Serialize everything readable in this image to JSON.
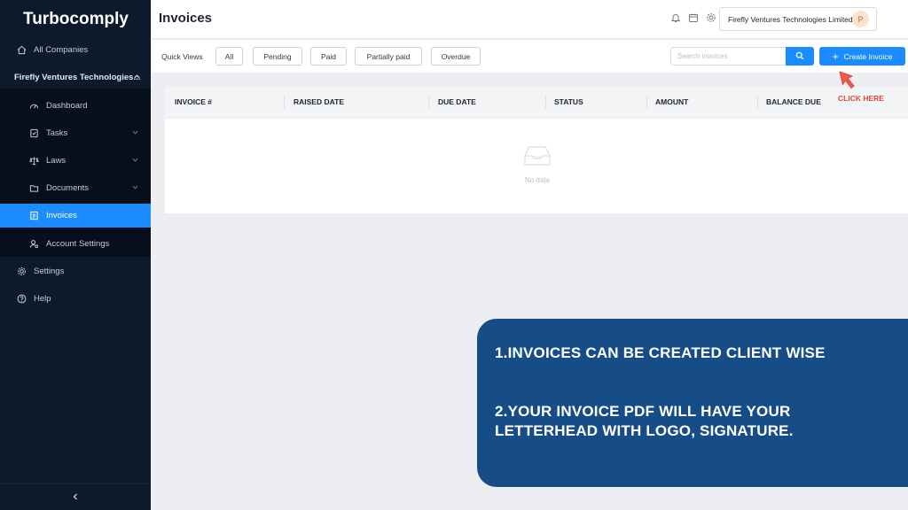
{
  "sidebar": {
    "brand": "Turbocomply",
    "all_companies": "All Companies",
    "company": "Firefly Ventures Technologies...",
    "items": [
      {
        "label": "Dashboard"
      },
      {
        "label": "Tasks"
      },
      {
        "label": "Laws"
      },
      {
        "label": "Documents"
      },
      {
        "label": "Invoices"
      },
      {
        "label": "Account Settings"
      }
    ],
    "settings": "Settings",
    "help": "Help",
    "collapse_icon": "chevron-left-icon"
  },
  "header": {
    "title": "Invoices",
    "company_select": "Firefly Ventures Technologies Limited",
    "avatar_initial": "P"
  },
  "quick_views": {
    "label": "Quick Views",
    "filters": [
      "All",
      "Pending",
      "Paid",
      "Partially paid",
      "Overdue"
    ],
    "search_placeholder": "Search invoices",
    "create_label": "Create Invoice"
  },
  "table": {
    "columns": [
      "INVOICE #",
      "RAISED DATE",
      "DUE DATE",
      "STATUS",
      "AMOUNT",
      "BALANCE DUE"
    ],
    "empty_text": "No data"
  },
  "annotation": {
    "click_here": "CLICK HERE",
    "color": "#e2473b"
  },
  "info_panel": {
    "line1": "1.INVOICES CAN BE CREATED CLIENT WISE",
    "line2": "2.YOUR INVOICE PDF WILL HAVE YOUR LETTERHEAD WITH LOGO, SIGNATURE."
  },
  "colors": {
    "accent": "#1a8cff",
    "sidebar": "#0d1a2c",
    "panel": "#164d86"
  }
}
